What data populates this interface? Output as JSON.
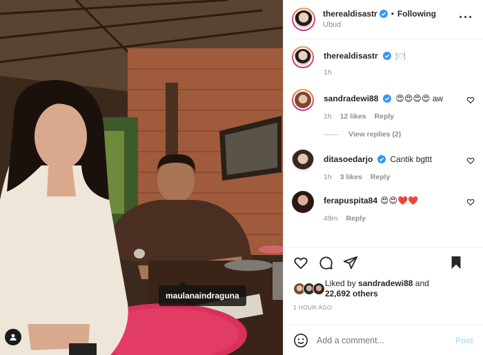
{
  "post": {
    "author": "therealdisastr",
    "follow_state": "Following",
    "location": "Ubud",
    "more_icon": "more-horizontal-icon"
  },
  "photo": {
    "tagged_user": "maulanaindraguna"
  },
  "caption": {
    "author": "therealdisastr",
    "text": "🍽",
    "time": "1h"
  },
  "comments": [
    {
      "author": "sandradewi88",
      "verified": true,
      "text": "😍😍😍😍 aw",
      "time": "1h",
      "likes": "12 likes",
      "reply": "Reply",
      "view_replies": "View replies (2)"
    },
    {
      "author": "ditasoedarjo",
      "verified": true,
      "text": "Cantik bgttt",
      "time": "1h",
      "likes": "3 likes",
      "reply": "Reply"
    },
    {
      "author": "ferapuspita84",
      "verified": false,
      "text": "😍😍❤️❤️",
      "time": "49m",
      "reply": "Reply"
    }
  ],
  "liked_by": {
    "prefix": "Liked by",
    "user": "sandradewi88",
    "and": "and",
    "others": "22,692 others"
  },
  "time_ago": "1 HOUR AGO",
  "add_comment": {
    "placeholder": "Add a comment...",
    "post_label": "Post"
  },
  "colors": {
    "verified": "#3897f0",
    "post_disabled": "#b2dffc",
    "meta": "#8e8e8e"
  }
}
